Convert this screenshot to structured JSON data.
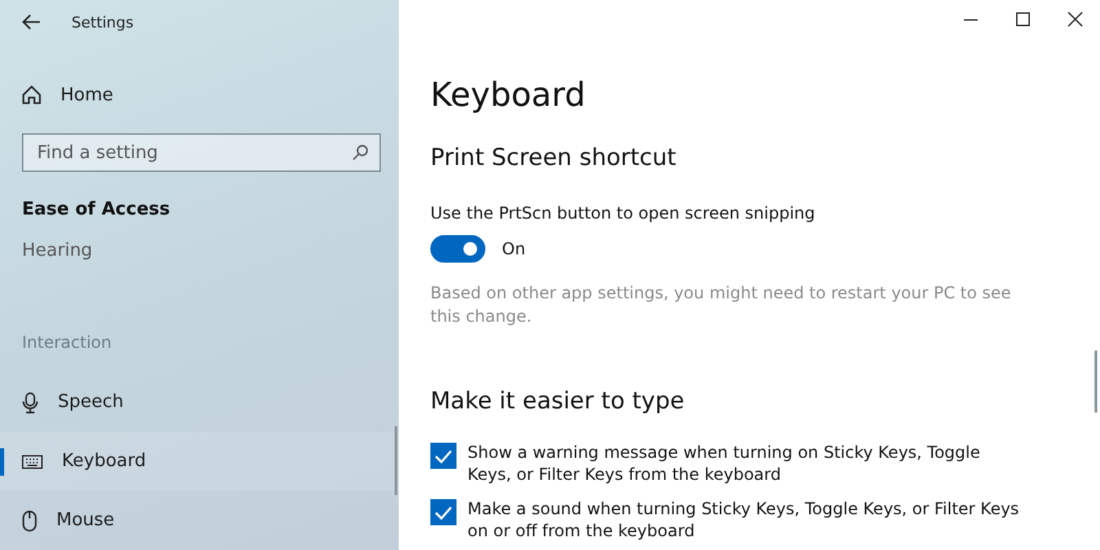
{
  "window": {
    "title": "Settings"
  },
  "sidebar": {
    "home": {
      "label": "Home"
    },
    "search": {
      "placeholder": "Find a setting"
    },
    "section": "Ease of Access",
    "items": [
      {
        "kind": "link",
        "label": "Hearing",
        "selected": false
      },
      {
        "kind": "group",
        "label": "Interaction"
      },
      {
        "kind": "link",
        "label": "Speech",
        "selected": false
      },
      {
        "kind": "link",
        "label": "Keyboard",
        "selected": true
      },
      {
        "kind": "link",
        "label": "Mouse",
        "selected": false
      }
    ]
  },
  "page": {
    "title": "Keyboard",
    "print_screen": {
      "heading": "Print Screen shortcut",
      "label": "Use the PrtScn button to open screen snipping",
      "toggle": {
        "on": true,
        "label": "On"
      },
      "note": "Based on other app settings, you might need to restart your PC to see this change."
    },
    "easier_typing": {
      "heading": "Make it easier to type",
      "options": [
        {
          "label": "Show a warning message when turning on Sticky Keys, Toggle Keys, or Filter Keys from the keyboard",
          "checked": true
        },
        {
          "label": "Make a sound when turning Sticky Keys, Toggle Keys, or Filter Keys on or off from the keyboard",
          "checked": true
        }
      ]
    }
  }
}
